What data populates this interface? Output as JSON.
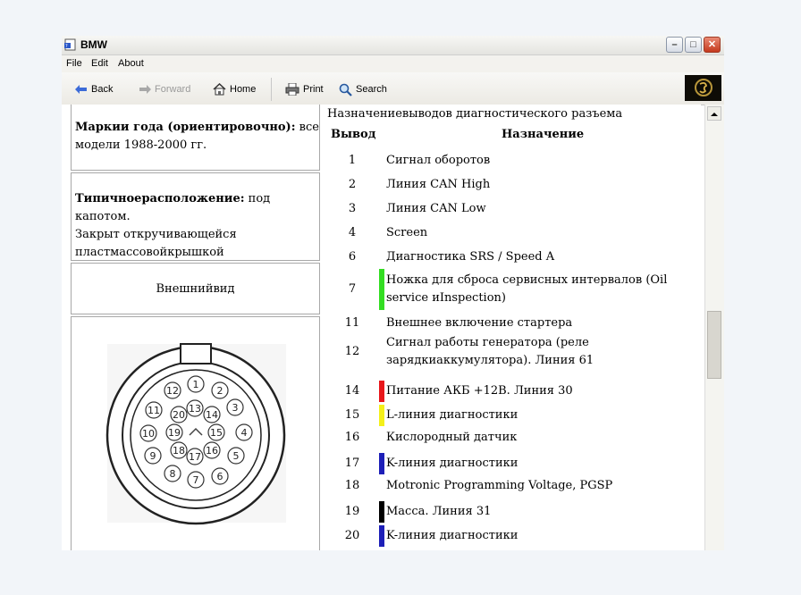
{
  "window": {
    "title": "BMW"
  },
  "menu": {
    "file": "File",
    "edit": "Edit",
    "about": "About"
  },
  "toolbar": {
    "back": "Back",
    "forward": "Forward",
    "home": "Home",
    "print": "Print",
    "search": "Search"
  },
  "left": {
    "years_label": "Маркии года (ориентировочно):",
    "years_rest": "все",
    "years_line2": "модели 1988-2000 гг.",
    "location_label": "Типичноерасположение:",
    "location_rest": "под капотом.",
    "location_line2": "Закрыт откручивающейся",
    "location_line3": "пластмассовойкрышкой",
    "appearance": "Внешнийвид",
    "connector_pins": [
      "1",
      "2",
      "3",
      "4",
      "5",
      "6",
      "7",
      "8",
      "9",
      "10",
      "11",
      "12",
      "13",
      "14",
      "15",
      "16",
      "17",
      "18",
      "19",
      "20"
    ]
  },
  "table": {
    "title": "Назначениевыводов диагностического разъема",
    "col_pin": "Вывод",
    "col_purpose": "Назначение",
    "rows": [
      {
        "pin": "1",
        "lines": [
          "Сигнал оборотов"
        ],
        "color": ""
      },
      {
        "pin": "2",
        "lines": [
          "Линия CAN High"
        ],
        "color": ""
      },
      {
        "pin": "3",
        "lines": [
          "Линия CAN Low"
        ],
        "color": ""
      },
      {
        "pin": "4",
        "lines": [
          "Screen"
        ],
        "color": ""
      },
      {
        "pin": "6",
        "lines": [
          "Диагностика SRS / Speed A"
        ],
        "color": ""
      },
      {
        "pin": "7",
        "lines": [
          "Ножка для сброса сервисных интервалов (Oil",
          "service иInspection)"
        ],
        "color": "#33dd22"
      },
      {
        "pin": "11",
        "lines": [
          "Внешнее включение стартера"
        ],
        "color": ""
      },
      {
        "pin": "12",
        "lines": [
          "Сигнал работы генератора (реле",
          "зарядкиаккумулятора). Линия 61"
        ],
        "color": ""
      },
      {
        "pin": "14",
        "lines": [
          "Питание АКБ +12В. Линия 30"
        ],
        "color": "#e8171b"
      },
      {
        "pin": "15",
        "lines": [
          "L-линия диагностики"
        ],
        "color": "#f4f01a"
      },
      {
        "pin": "16",
        "lines": [
          "Кислородный датчик"
        ],
        "color": ""
      },
      {
        "pin": "17",
        "lines": [
          "K-линия диагностики"
        ],
        "color": "#1d1fb8"
      },
      {
        "pin": "18",
        "lines": [
          "Motronic Programming Voltage, PGSP"
        ],
        "color": ""
      },
      {
        "pin": "19",
        "lines": [
          "Масса. Линия 31"
        ],
        "color": "#000000"
      },
      {
        "pin": "20",
        "lines": [
          "K-линия диагностики"
        ],
        "color": "#1d1fb8"
      }
    ]
  }
}
